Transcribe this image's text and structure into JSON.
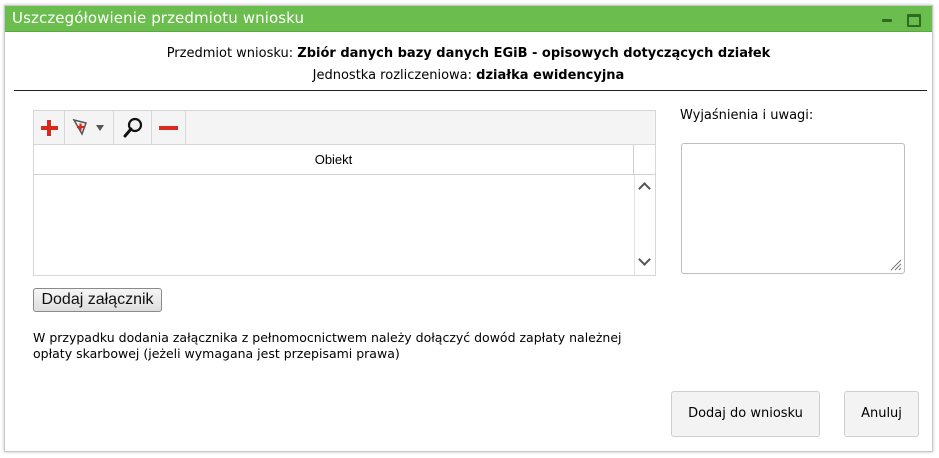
{
  "window": {
    "title": "Uszczegółowienie przedmiotu wniosku",
    "controls": {
      "minimize_icon": "minimize-icon",
      "maximize_icon": "maximize-icon"
    }
  },
  "header": {
    "subject_label": "Przedmiot wniosku:",
    "subject_value": "Zbiór danych bazy danych EGiB - opisowych dotyczących działek",
    "unit_label": "Jednostka rozliczeniowa:",
    "unit_value": "działka ewidencyjna"
  },
  "toolbar": {
    "buttons": [
      {
        "icon": "plus-icon",
        "color": "#d42b1e"
      },
      {
        "icon": "map-pick-dropdown-icon"
      },
      {
        "icon": "magnifier-icon"
      },
      {
        "icon": "minus-icon",
        "color": "#d42b1e"
      }
    ]
  },
  "grid": {
    "columns": [
      "Obiekt"
    ],
    "rows": []
  },
  "attach_button": "Dodaj załącznik",
  "note": "W przypadku dodania załącznika z pełnomocnictwem należy dołączyć dowód zapłaty należnej opłaty skarbowej (jeżeli wymagana jest przepisami prawa)",
  "remarks": {
    "label": "Wyjaśnienia i uwagi:",
    "value": ""
  },
  "actions": {
    "add_to_request": "Dodaj do wniosku",
    "cancel": "Anuluj"
  },
  "colors": {
    "titlebar": "#6bbe4e",
    "accent_red": "#d42b1e"
  }
}
